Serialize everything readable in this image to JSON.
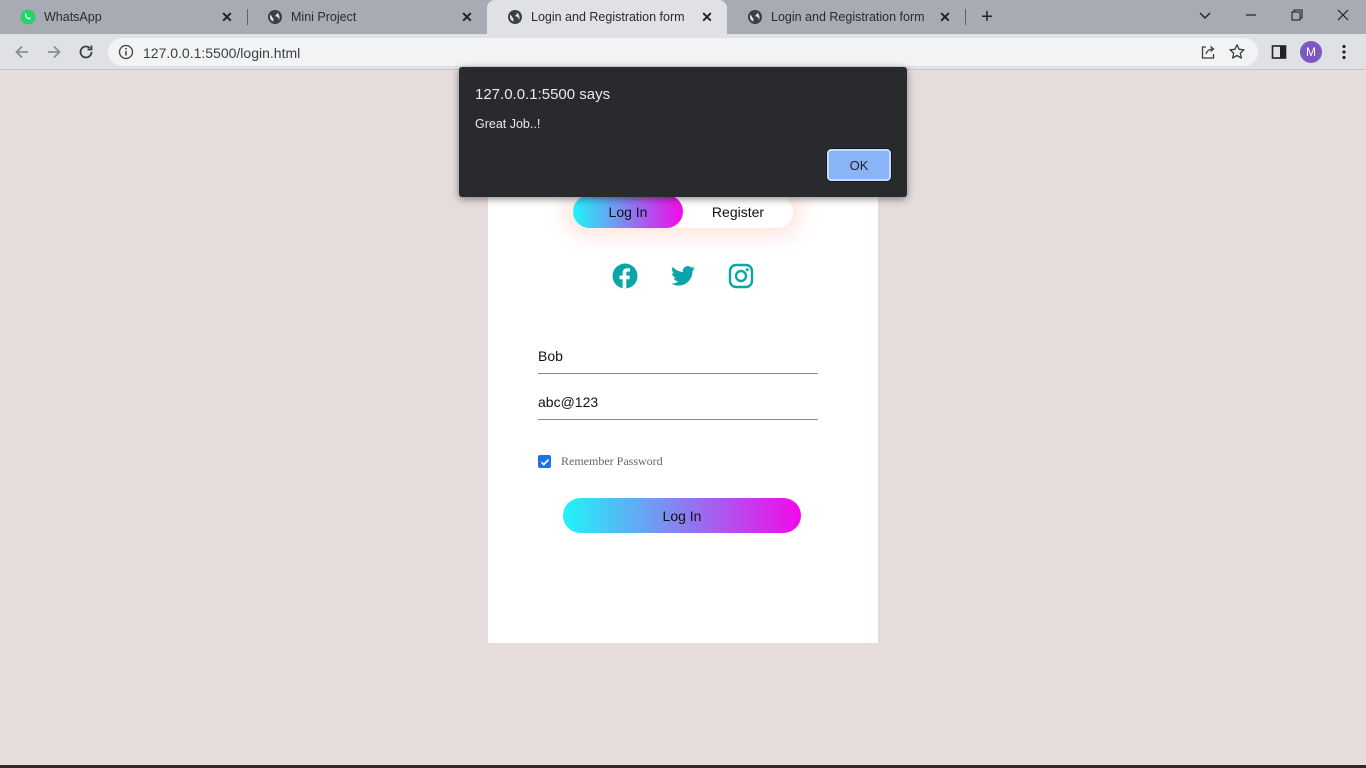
{
  "browser": {
    "tabs": [
      {
        "title": "WhatsApp",
        "icon": "whatsapp-icon"
      },
      {
        "title": "Mini Project",
        "icon": "globe-icon"
      },
      {
        "title": "Login and Registration form",
        "icon": "globe-icon",
        "active": true
      },
      {
        "title": "Login and Registration form",
        "icon": "globe-icon"
      }
    ],
    "close_glyph": "✕",
    "new_tab_glyph": "+",
    "url": "127.0.0.1:5500/login.html",
    "profile_initial": "M"
  },
  "page": {
    "toggle": {
      "login_label": "Log In",
      "register_label": "Register"
    },
    "social_icons": [
      "facebook-icon",
      "twitter-icon",
      "instagram-icon"
    ],
    "username_value": "Bob",
    "password_value": "abc@123",
    "remember_label": "Remember Password",
    "remember_checked": true,
    "submit_label": "Log In"
  },
  "dialog": {
    "title": "127.0.0.1:5500 says",
    "message": "Great Job..!",
    "ok_label": "OK"
  },
  "colors": {
    "page_background": "#e6dcdc",
    "gradient_start": "#1ff4f8",
    "gradient_end": "#f309e9",
    "social_icon": "#0aa5a8",
    "dialog_background": "#292a2d",
    "dialog_button": "#8ab4f8"
  }
}
